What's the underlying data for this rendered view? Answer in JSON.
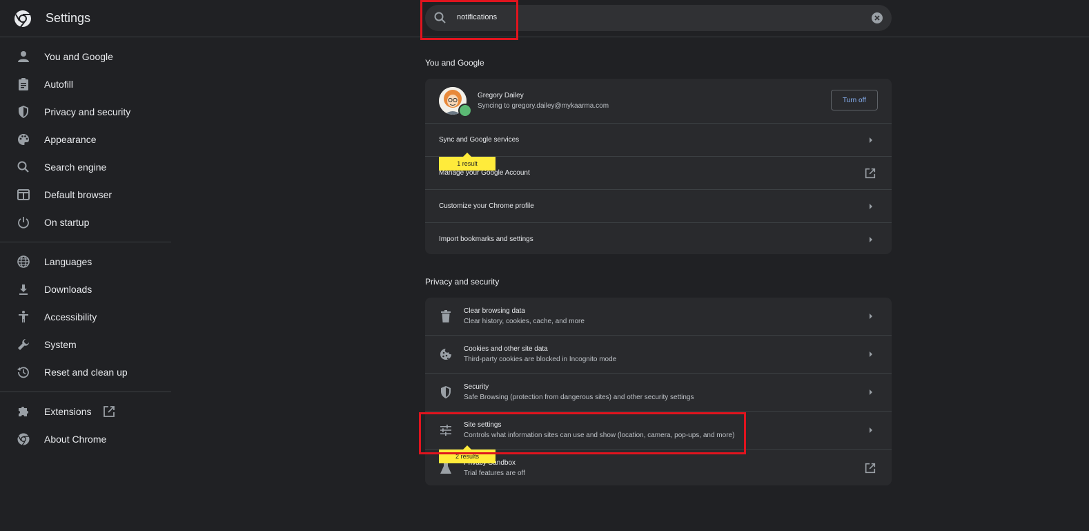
{
  "app": {
    "title": "Settings"
  },
  "search": {
    "value": "notifications"
  },
  "sidebar": {
    "group1": [
      {
        "label": "You and Google",
        "icon": "person-icon"
      },
      {
        "label": "Autofill",
        "icon": "clipboard-icon"
      },
      {
        "label": "Privacy and security",
        "icon": "shield-icon"
      },
      {
        "label": "Appearance",
        "icon": "palette-icon"
      },
      {
        "label": "Search engine",
        "icon": "search-icon"
      },
      {
        "label": "Default browser",
        "icon": "browser-window-icon"
      },
      {
        "label": "On startup",
        "icon": "power-icon"
      }
    ],
    "group2": [
      {
        "label": "Languages",
        "icon": "globe-icon"
      },
      {
        "label": "Downloads",
        "icon": "download-icon"
      },
      {
        "label": "Accessibility",
        "icon": "accessibility-icon"
      },
      {
        "label": "System",
        "icon": "wrench-icon"
      },
      {
        "label": "Reset and clean up",
        "icon": "history-icon"
      }
    ],
    "group3": [
      {
        "label": "Extensions",
        "icon": "puzzle-icon"
      },
      {
        "label": "About Chrome",
        "icon": "chrome-icon"
      }
    ]
  },
  "you_and_google": {
    "title": "You and Google",
    "profile": {
      "name": "Gregory Dailey",
      "email": "Syncing to gregory.dailey@mykaarma.com",
      "turn_off_label": "Turn off"
    },
    "rows": [
      {
        "label": "Sync and Google services"
      },
      {
        "label": "Manage your Google Account"
      },
      {
        "label": "Customize your Chrome profile"
      },
      {
        "label": "Import bookmarks and settings"
      }
    ],
    "result_bubble": "1 result"
  },
  "privacy": {
    "title": "Privacy and security",
    "rows": [
      {
        "title": "Clear browsing data",
        "subtitle": "Clear history, cookies, cache, and more",
        "icon": "trash-icon"
      },
      {
        "title": "Cookies and other site data",
        "subtitle": "Third-party cookies are blocked in Incognito mode",
        "icon": "cookie-icon"
      },
      {
        "title": "Security",
        "subtitle": "Safe Browsing (protection from dangerous sites) and other security settings",
        "icon": "shield-icon"
      },
      {
        "title": "Site settings",
        "subtitle": "Controls what information sites can use and show (location, camera, pop-ups, and more)",
        "icon": "sliders-icon"
      },
      {
        "title": "Privacy Sandbox",
        "subtitle": "Trial features are off",
        "icon": "flask-icon"
      }
    ],
    "result_bubble": "2 results"
  },
  "colors": {
    "background": "#202124",
    "card": "#292a2d",
    "highlight": "#ffeb3b",
    "annotation": "#e0141e",
    "link": "#8ab4f8"
  }
}
